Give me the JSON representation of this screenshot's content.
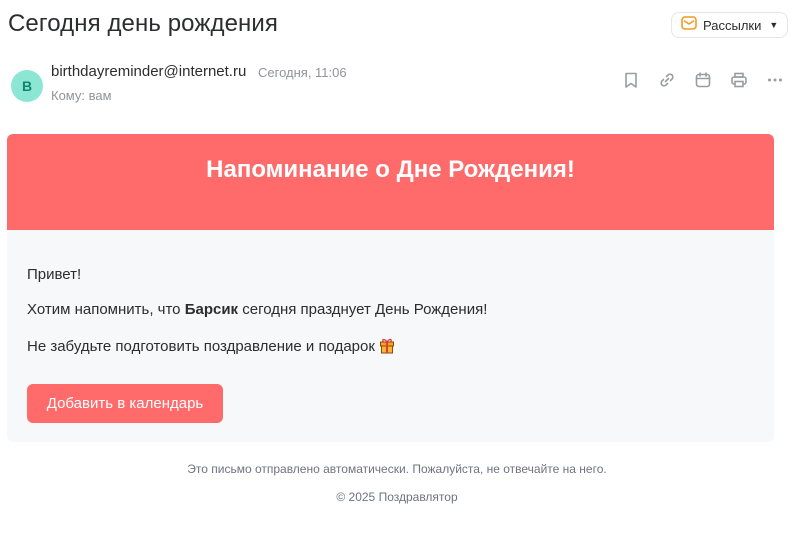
{
  "subject": "Сегодня день рождения",
  "category": {
    "label": "Рассылки",
    "icon": "newsletter-envelope-icon"
  },
  "sender": {
    "avatar_letter": "B",
    "email": "birthdayreminder@internet.ru",
    "date": "Сегодня, 11:06",
    "to": "Кому: вам"
  },
  "toolbar": {
    "icons": [
      "bookmark-icon",
      "link-icon",
      "calendar-icon",
      "print-icon",
      "more-icon"
    ]
  },
  "email": {
    "heading": "Напоминание о Дне Рождения!",
    "greeting": "Привет!",
    "line2_prefix": "Хотим напомнить, что ",
    "line2_name": "Барсик",
    "line2_suffix": " сегодня празднует День Рождения!",
    "line3": "Не забудьте подготовить поздравление и подарок",
    "button_label": "Добавить в календарь",
    "accent_color": "#ff6b6b"
  },
  "footer": {
    "note": "Это письмо отправлено автоматически. Пожалуйста, не отвечайте на него.",
    "copyright": "© 2025 Поздравлятор"
  }
}
